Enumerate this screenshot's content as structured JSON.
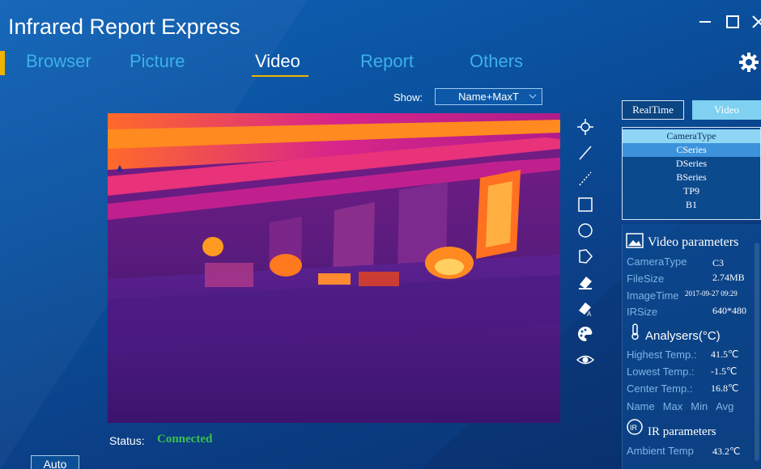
{
  "app": {
    "title": "Infrared Report Express"
  },
  "nav": {
    "tabs": [
      "Browser",
      "Picture",
      "Video",
      "Report",
      "Others"
    ],
    "active": "Video"
  },
  "toolbar": {
    "show_label": "Show:",
    "show_value": "Name+MaxT"
  },
  "tools": [
    "crosshair-icon",
    "line-icon",
    "dashed-line-icon",
    "rectangle-icon",
    "circle-icon",
    "polygon-icon",
    "eraser-icon",
    "eraser-all-icon",
    "palette-icon",
    "eye-icon"
  ],
  "mode": {
    "realtime_label": "RealTime",
    "video_label": "Video"
  },
  "camera_list": {
    "header": "CameraType",
    "items": [
      "CSeries",
      "DSeries",
      "BSeries",
      "TP9",
      "B1"
    ],
    "selected": "CSeries"
  },
  "video_parameters": {
    "title": "Video parameters",
    "camera_type_label": "CameraType",
    "camera_type_value": "C3",
    "file_size_label": "FileSize",
    "file_size_value": "2.74MB",
    "image_time_label": "ImageTime",
    "image_time_value": "2017-09-27 09:29",
    "ir_size_label": "IRSize",
    "ir_size_value": "640*480"
  },
  "analysers": {
    "title": "Analysers(°C)",
    "highest_label": "Highest Temp.:",
    "highest_value": "41.5℃",
    "lowest_label": "Lowest Temp.:",
    "lowest_value": "-1.5℃",
    "center_label": "Center Temp.:",
    "center_value": "16.8℃",
    "columns": [
      "Name",
      "Max",
      "Min",
      "Avg"
    ]
  },
  "ir_parameters": {
    "title": "IR parameters",
    "ambient_label": "Ambient Temp",
    "ambient_value": "43.2℃"
  },
  "status": {
    "label": "Status:",
    "value": "Connected"
  },
  "auto_button": "Auto",
  "colors": {
    "background": "#0b56a6",
    "accent": "#f0b400",
    "tab_inactive": "#3db1ea",
    "status_ok": "#39c24a",
    "selected_row": "#3c93dc"
  }
}
